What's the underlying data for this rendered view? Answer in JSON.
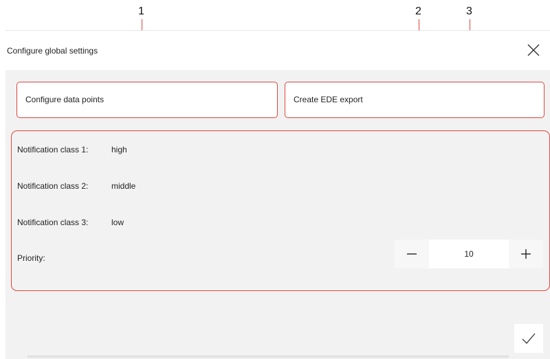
{
  "callouts": [
    "1",
    "2",
    "3"
  ],
  "dialog": {
    "title": "Configure global settings",
    "close_icon": "close-icon",
    "confirm_icon": "checkmark-icon"
  },
  "tiles": {
    "configure_data_points": "Configure data points",
    "create_ede_export": "Create EDE export"
  },
  "settings": {
    "rows": [
      {
        "label": "Notification class 1:",
        "value": "high"
      },
      {
        "label": "Notification class 2:",
        "value": "middle"
      },
      {
        "label": "Notification class 3:",
        "value": "low"
      }
    ],
    "priority": {
      "label": "Priority:",
      "value": "10",
      "decrement_icon": "minus-icon",
      "increment_icon": "plus-icon"
    }
  },
  "colors": {
    "callout": "#e0443e",
    "dialog_bg": "#f2f2f2"
  }
}
